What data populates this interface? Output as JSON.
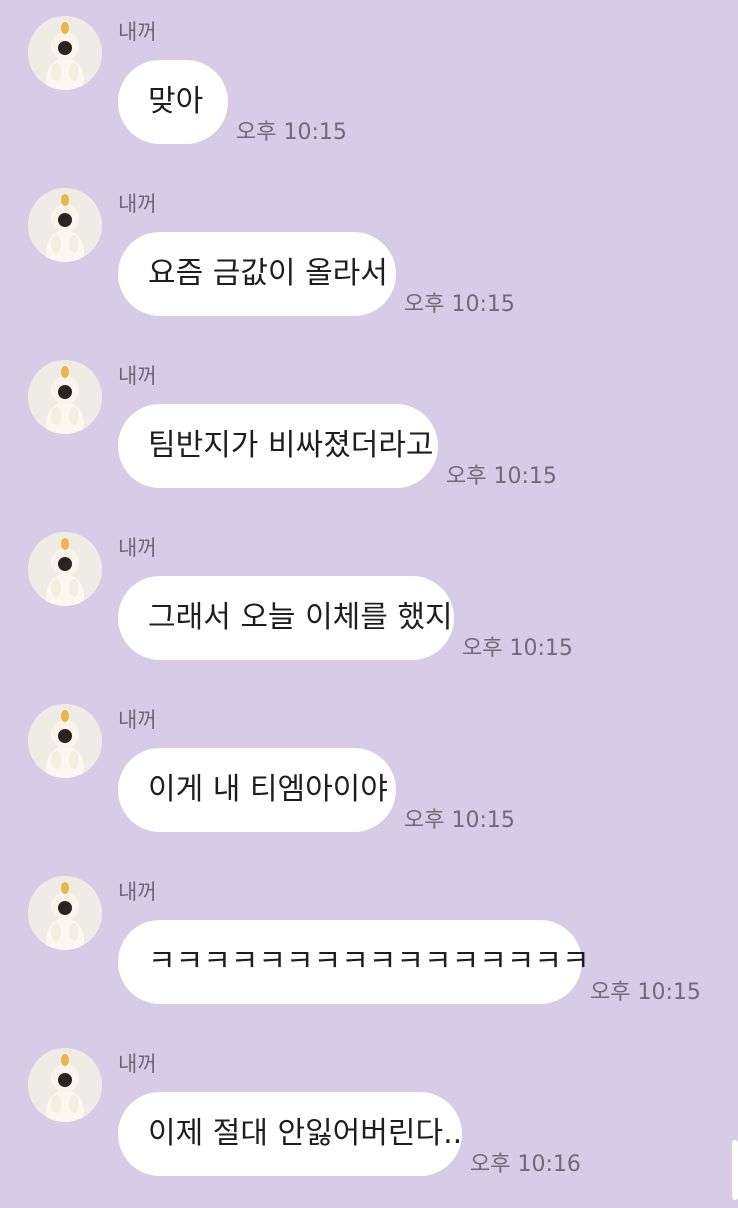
{
  "messages": [
    {
      "sender": "내꺼",
      "text": "맞아",
      "time": "오후 10:15"
    },
    {
      "sender": "내꺼",
      "text": "요즘 금값이 올라서",
      "time": "오후 10:15"
    },
    {
      "sender": "내꺼",
      "text": "팀반지가 비싸졌더라고",
      "time": "오후 10:15"
    },
    {
      "sender": "내꺼",
      "text": "그래서 오늘 이체를 했지",
      "time": "오후 10:15"
    },
    {
      "sender": "내꺼",
      "text": "이게 내 티엠아이야",
      "time": "오후 10:15"
    },
    {
      "sender": "내꺼",
      "text": "ㅋㅋㅋㅋㅋㅋㅋㅋㅋㅋㅋㅋㅋㅋㅋㅋ",
      "time": "오후 10:15"
    },
    {
      "sender": "내꺼",
      "text": "이제 절대 안잃어버린다..",
      "time": "오후 10:16"
    }
  ],
  "icons": {
    "avatar": "profile-photo-person-in-white-hood"
  },
  "colors": {
    "background": "#d6cce8",
    "bubble": "#ffffff",
    "text": "#1e1e1e",
    "meta": "#6f6a7a"
  }
}
